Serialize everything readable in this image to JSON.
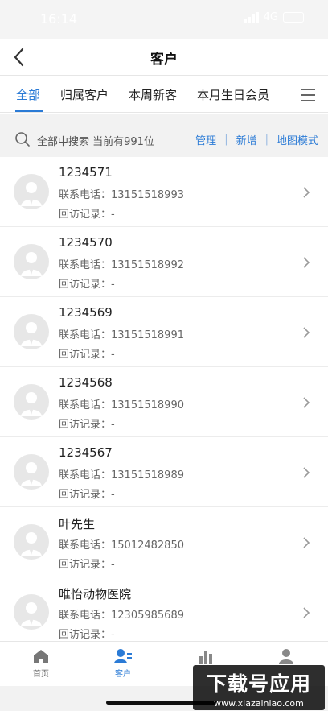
{
  "status": {
    "time": "16:14",
    "network": "4G"
  },
  "header": {
    "title": "客户"
  },
  "tabs": [
    {
      "label": "全部",
      "active": true
    },
    {
      "label": "归属客户",
      "active": false
    },
    {
      "label": "本周新客",
      "active": false
    },
    {
      "label": "本月生日会员",
      "active": false
    }
  ],
  "search": {
    "prompt": "全部中搜索 当前有991位",
    "actions": [
      "管理",
      "新增",
      "地图模式"
    ]
  },
  "customers": [
    {
      "name": "1234571",
      "phone_label": "联系电话：",
      "phone": "13151518993",
      "visit_label": "回访记录：",
      "visit": "-"
    },
    {
      "name": "1234570",
      "phone_label": "联系电话：",
      "phone": "13151518992",
      "visit_label": "回访记录：",
      "visit": "-"
    },
    {
      "name": "1234569",
      "phone_label": "联系电话：",
      "phone": "13151518991",
      "visit_label": "回访记录：",
      "visit": "-"
    },
    {
      "name": "1234568",
      "phone_label": "联系电话：",
      "phone": "13151518990",
      "visit_label": "回访记录：",
      "visit": "-"
    },
    {
      "name": "1234567",
      "phone_label": "联系电话：",
      "phone": "13151518989",
      "visit_label": "回访记录：",
      "visit": "-"
    },
    {
      "name": "叶先生",
      "phone_label": "联系电话：",
      "phone": "15012482850",
      "visit_label": "回访记录：",
      "visit": "-"
    },
    {
      "name": "唯怡动物医院",
      "phone_label": "联系电话：",
      "phone": "12305985689",
      "visit_label": "回访记录：",
      "visit": "-"
    }
  ],
  "tabbar": [
    {
      "label": "首页",
      "icon": "home-icon",
      "active": false
    },
    {
      "label": "客户",
      "icon": "customer-icon",
      "active": true
    },
    {
      "label": "",
      "icon": "stats-icon",
      "active": false
    },
    {
      "label": "",
      "icon": "profile-icon",
      "active": false
    }
  ],
  "watermark": {
    "title": "下载号应用",
    "url": "www.xiazainiao.com"
  },
  "colors": {
    "accent": "#2b7bd6",
    "search_bg": "#f2f2f2",
    "avatar_bg": "#e7e7e7"
  }
}
